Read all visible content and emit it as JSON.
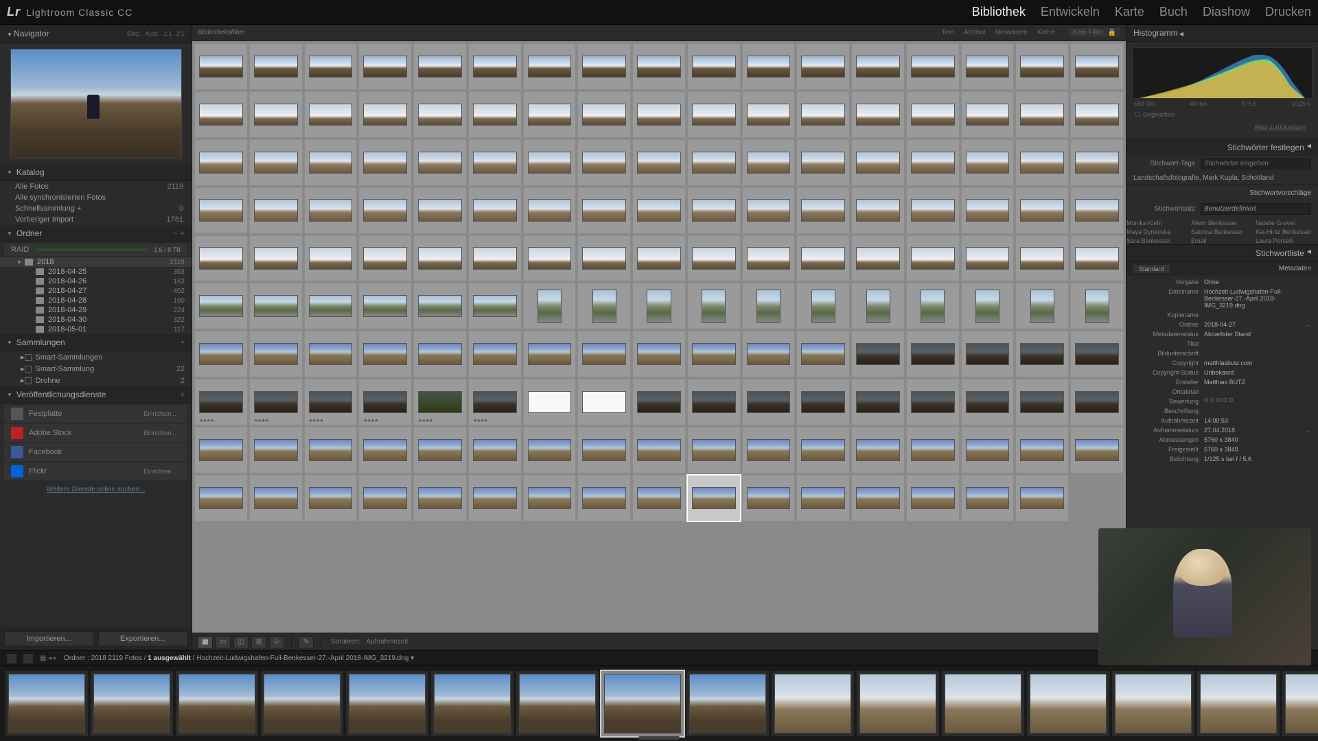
{
  "app": {
    "logo_mark": "Lr",
    "name": "Lightroom Classic CC"
  },
  "modules": {
    "items": [
      "Bibliothek",
      "Entwickeln",
      "Karte",
      "Buch",
      "Diashow",
      "Drucken"
    ],
    "active": 0
  },
  "navigator": {
    "title": "Navigator",
    "opts": [
      "Einp.",
      "Ausf.",
      "1:1",
      "3:1"
    ]
  },
  "catalog": {
    "title": "Katalog",
    "items": [
      {
        "name": "Alle Fotos",
        "count": "2119"
      },
      {
        "name": "Alle synchronisierten Fotos",
        "count": ""
      },
      {
        "name": "Schnellsammlung  +",
        "count": "0"
      },
      {
        "name": "Vorheriger Import",
        "count": "1781"
      }
    ]
  },
  "folders": {
    "title": "Ordner",
    "drive": {
      "name": "RAID",
      "info": "1,6 / 8 TB"
    },
    "tree": [
      {
        "name": "2018",
        "count": "2119",
        "sel": true,
        "indent": 1
      },
      {
        "name": "2018-04-25",
        "count": "363",
        "indent": 2
      },
      {
        "name": "2018-04-26",
        "count": "163",
        "indent": 2
      },
      {
        "name": "2018-04-27",
        "count": "402",
        "indent": 2
      },
      {
        "name": "2018-04-28",
        "count": "160",
        "indent": 2
      },
      {
        "name": "2018-04-29",
        "count": "224",
        "indent": 2
      },
      {
        "name": "2018-04-30",
        "count": "322",
        "indent": 2
      },
      {
        "name": "2018-05-01",
        "count": "117",
        "indent": 2
      }
    ]
  },
  "collections": {
    "title": "Sammlungen",
    "items": [
      {
        "name": "Smart-Sammlungen",
        "count": ""
      },
      {
        "name": "Smart-Sammlung",
        "count": "22"
      },
      {
        "name": "Drohne",
        "count": "2"
      }
    ]
  },
  "publish": {
    "title": "Veröffentlichungsdienste",
    "items": [
      {
        "name": "Festplatte",
        "color": "#555",
        "btn": "Einrichten..."
      },
      {
        "name": "Adobe Stock",
        "color": "#c02020",
        "btn": "Einrichten..."
      },
      {
        "name": "Facebook",
        "color": "#3b5998",
        "btn": ""
      },
      {
        "name": "Flickr",
        "color": "#0063dc",
        "btn": "Einrichten..."
      }
    ],
    "more": "Weitere Dienste online suchen..."
  },
  "left_buttons": {
    "import": "Importieren...",
    "export": "Exportieren..."
  },
  "filter_bar": {
    "title": "Bibliotheksfilter:",
    "tabs": [
      "Text",
      "Attribut",
      "Metadaten",
      "Keine"
    ],
    "lock": "Kein Filter"
  },
  "toolbar": {
    "sort_label": "Sortieren:",
    "sort_value": "Aufnahmezeit"
  },
  "histogram": {
    "title": "Histogramm",
    "info": [
      "ISO 100",
      "40 mm",
      "f / 5,6",
      "1/125 s"
    ],
    "original": "Originalfoto",
    "reset": "Alles zurücksetzen"
  },
  "keywords": {
    "title": "Stichwörter festlegen",
    "tags_label": "Stichwort-Tags",
    "tags_ph": "Stichwörter eingeben",
    "existing": "Landschaftsfotografie, Mark Kupla, Schottland",
    "sug_title": "Stichwortvorschläge",
    "set_label": "Stichwortsatz",
    "set_value": "Benutzerdefiniert",
    "names": [
      "Monika Kiehl",
      "Allem Benkesser",
      "Natalie Grever",
      "Maya Dynkoska",
      "Sabrina Benkesser",
      "Kai-Hintz Benkesser",
      "Sara Benkesser",
      "Email",
      "Laura Porcelli"
    ],
    "list_title": "Stichwortliste"
  },
  "metadata": {
    "title": "Metadaten",
    "preset_label": "Standard",
    "rows": [
      {
        "label": "Vorgabe",
        "value": "Ohne",
        "dd": true
      },
      {
        "label": "Dateiname",
        "value": "Hochzeit-Ludwigshafen-Full-Benkesser-27.-April 2018-IMG_3219.dng"
      },
      {
        "label": "Kopiename",
        "value": ""
      },
      {
        "label": "Ordner",
        "value": "2018-04-27",
        "act": "→"
      },
      {
        "label": "Metadatenstatus",
        "value": "Aktuellster Stand"
      },
      {
        "label": "Titel",
        "value": ""
      },
      {
        "label": "Bildunterschrift",
        "value": ""
      },
      {
        "label": "Copyright",
        "value": "matthiasbutz.com"
      },
      {
        "label": "Copyright-Status",
        "value": "Unbekannt",
        "dd": true
      },
      {
        "label": "Ersteller",
        "value": "Matthias BUTZ"
      },
      {
        "label": "Ortsdetail",
        "value": ""
      },
      {
        "label": "Bewertung",
        "value": "rating"
      },
      {
        "label": "Beschriftung",
        "value": ""
      },
      {
        "label": "Aufnahmezeit",
        "value": "14:00:53"
      },
      {
        "label": "Aufnahmedatum",
        "value": "27.04.2018",
        "act": "→"
      },
      {
        "label": "Abmessungen",
        "value": "5760 x 3840"
      },
      {
        "label": "Freigestellt",
        "value": "5760 x 3840"
      },
      {
        "label": "Belichtung",
        "value": "1/125 s bei f / 5,6"
      }
    ]
  },
  "status": {
    "path_prefix": "Ordner : 2018    2119 Fotos /",
    "selected": "1 ausgewählt",
    "filename": "/ Hochzeit-Ludwigshafen-Full-Benkesser-27.-April 2018-IMG_3219.dng  ▾"
  },
  "grid": {
    "rows": [
      {
        "style": "t-sky",
        "cols": 17
      },
      {
        "style": "t-pano",
        "cols": 17
      },
      {
        "style": "t-wide",
        "cols": 17
      },
      {
        "style": "t-wide",
        "cols": 17
      },
      {
        "style": "t-pano",
        "cols": 17
      },
      {
        "style": "t-river",
        "cols": 17,
        "vertical_from": 6
      },
      {
        "style": "t-road",
        "cols": 17,
        "dark_from": 12
      },
      {
        "style": "t-dark",
        "cols": 17,
        "stars": 6,
        "white": [
          6,
          7
        ],
        "green": 4
      },
      {
        "style": "t-road",
        "cols": 17
      },
      {
        "style": "t-road",
        "cols": 16,
        "sel": 9
      }
    ]
  },
  "filmstrip": {
    "selected": 7,
    "count": 17
  }
}
